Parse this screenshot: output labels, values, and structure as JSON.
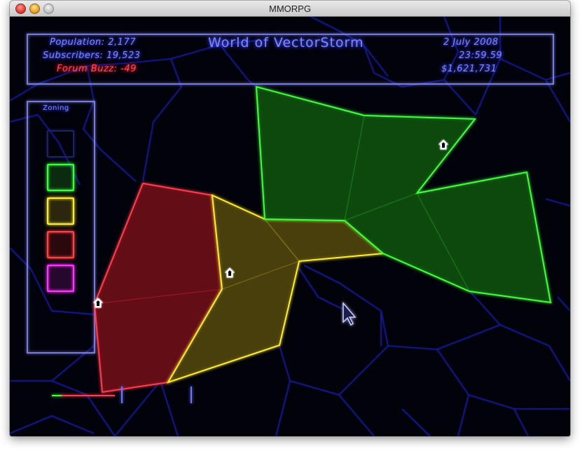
{
  "window": {
    "title": "MMORPG"
  },
  "hud": {
    "world_title": "World of VectorStorm",
    "population": "Population: 2,177",
    "subscribers": "Subscribers: 19,523",
    "forum_buzz": "Forum Buzz: -49",
    "date": "2 July 2008",
    "time": "23:59.59",
    "money": "$1,621,731"
  },
  "zoning_panel": {
    "label": "Zoning",
    "swatches": [
      {
        "name": "empty",
        "color": "#1b2266"
      },
      {
        "name": "green",
        "color": "#3cff3c"
      },
      {
        "name": "yellow",
        "color": "#ffee30"
      },
      {
        "name": "red",
        "color": "#ff4242"
      },
      {
        "name": "magenta",
        "color": "#ff35ff"
      }
    ]
  },
  "colors": {
    "background": "#02020b",
    "grid": "#1a22b8",
    "hud_frame": "#8c90ff",
    "green_zone": "#42ff3a",
    "yellow_zone": "#ffee2a",
    "red_zone": "#ff3d4d"
  },
  "icons": [
    "house-icon",
    "mouse-cursor-icon"
  ]
}
